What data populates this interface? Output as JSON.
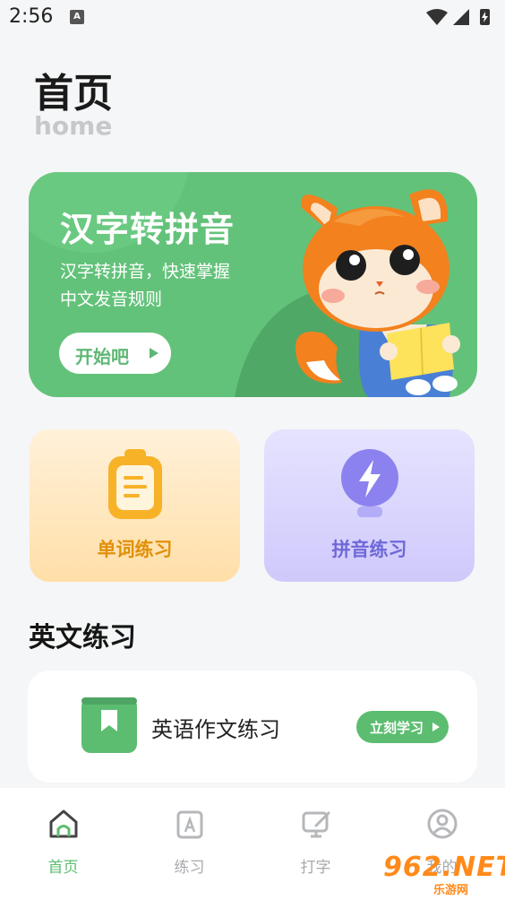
{
  "status_bar": {
    "time": "2:56",
    "notification_icon": "A"
  },
  "header": {
    "title": "首页",
    "subtitle": "home"
  },
  "banner": {
    "title": "汉字转拼音",
    "desc_line1": "汉字转拼音，快速掌握",
    "desc_line2": "中文发音规则",
    "button_label": "开始吧",
    "colors": {
      "bg": "#63c27a",
      "text": "#ffffff"
    }
  },
  "cards": [
    {
      "label": "单词练习",
      "icon": "clipboard-icon"
    },
    {
      "label": "拼音练习",
      "icon": "lightbulb-bolt-icon"
    }
  ],
  "section": {
    "title": "英文练习"
  },
  "essay": {
    "label": "英语作文练习",
    "button_label": "立刻学习",
    "icon": "bookmark-book-icon"
  },
  "tabs": [
    {
      "label": "首页",
      "icon": "home-icon",
      "active": true
    },
    {
      "label": "练习",
      "icon": "practice-icon",
      "active": false
    },
    {
      "label": "打字",
      "icon": "typing-icon",
      "active": false
    },
    {
      "label": "我的",
      "icon": "profile-icon",
      "active": false
    }
  ],
  "watermark": {
    "text": "962.NET",
    "sub": "乐游网"
  },
  "accent_color": "#5cbd71"
}
